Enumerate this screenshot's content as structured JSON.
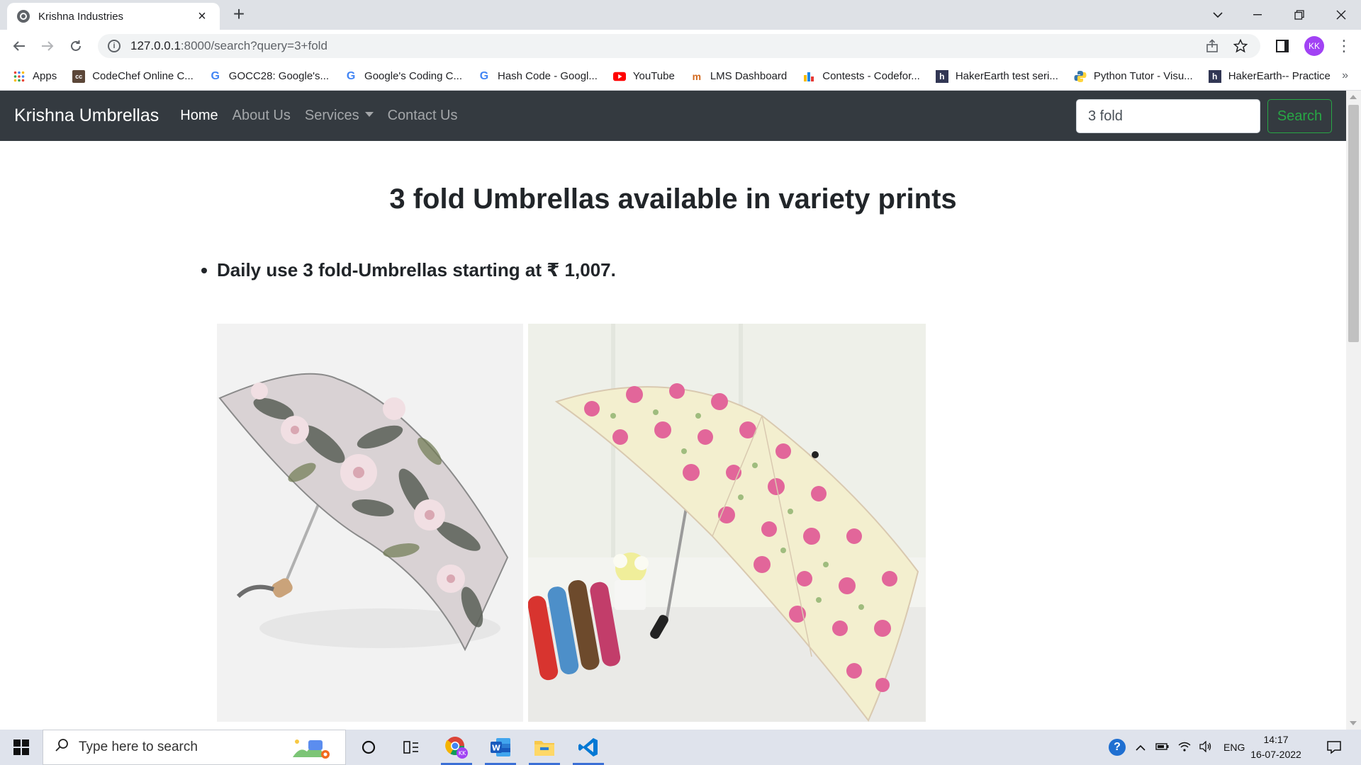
{
  "browser": {
    "tab_title": "Krishna Industries",
    "tab_close": "×",
    "new_tab": "+",
    "url_host": "127.0.0.1",
    "url_path": ":8000/search?query=3+fold",
    "profile_initials": "KK",
    "bookmarks": [
      {
        "label": "Apps",
        "icon": "apps-grid-icon"
      },
      {
        "label": "CodeChef Online C...",
        "icon": "codechef-icon"
      },
      {
        "label": "GOCC28: Google's...",
        "icon": "google-icon"
      },
      {
        "label": "Google's Coding C...",
        "icon": "google-icon"
      },
      {
        "label": "Hash Code - Googl...",
        "icon": "google-icon"
      },
      {
        "label": "YouTube",
        "icon": "youtube-icon"
      },
      {
        "label": "LMS Dashboard",
        "icon": "lms-icon"
      },
      {
        "label": "Contests - Codefor...",
        "icon": "codeforces-icon"
      },
      {
        "label": "HakerEarth test seri...",
        "icon": "hackerearth-icon"
      },
      {
        "label": "Python Tutor - Visu...",
        "icon": "python-icon"
      },
      {
        "label": "HakerEarth-- Practice",
        "icon": "hackerearth-icon"
      }
    ],
    "bookmarks_more": "»"
  },
  "site": {
    "brand": "Krishna Umbrellas",
    "nav": {
      "home": "Home",
      "about": "About Us",
      "services": "Services",
      "contact": "Contact Us"
    },
    "search_value": "3 fold",
    "search_button": "Search",
    "heading": "3 fold Umbrellas available in variety prints",
    "bullet": "Daily use 3 fold-Umbrellas starting at ₹ 1,007."
  },
  "taskbar": {
    "search_placeholder": "Type here to search",
    "language": "ENG",
    "time": "14:17",
    "date": "16-07-2022"
  },
  "colors": {
    "navbar_bg": "#343a40",
    "search_green": "#28a745",
    "tabstrip_bg": "#dee1e6",
    "profile_purple": "#a142f4"
  }
}
